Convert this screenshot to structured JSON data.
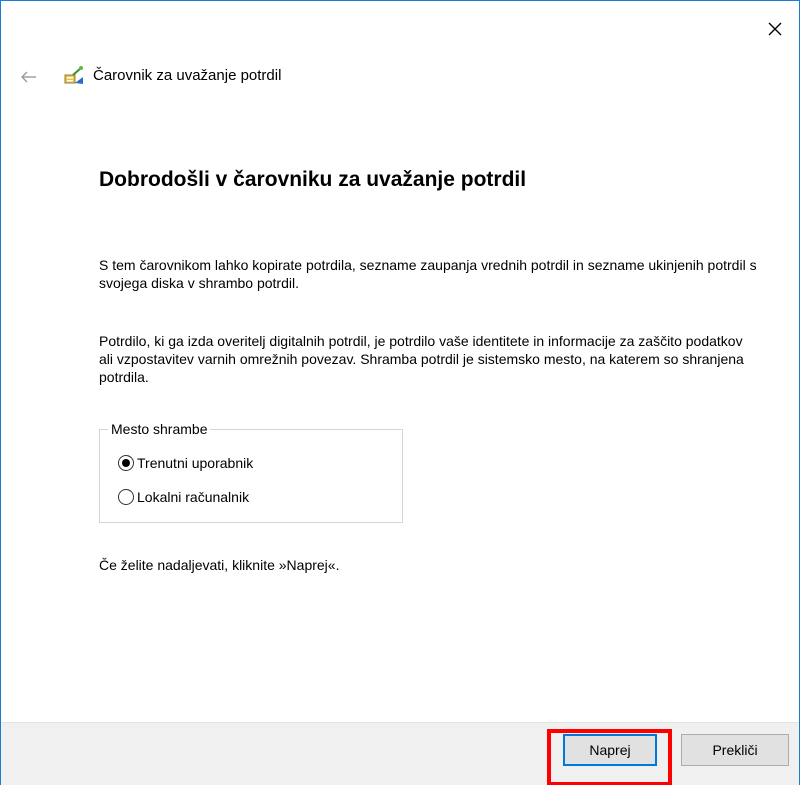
{
  "window": {
    "title": "Čarovnik za uvažanje potrdil"
  },
  "icons": {
    "close": "close-icon",
    "back": "back-arrow-icon",
    "wizard": "certificate-wizard-icon"
  },
  "content": {
    "heading": "Dobrodošli v čarovniku za uvažanje potrdil",
    "paragraph1": "S tem čarovnikom lahko kopirate potrdila, sezname zaupanja vrednih potrdil in sezname ukinjenih potrdil s svojega diska v shrambo potrdil.",
    "paragraph2": "Potrdilo, ki ga izda overitelj digitalnih potrdil, je potrdilo vaše identitete in informacije za zaščito podatkov ali vzpostavitev varnih omrežnih povezav. Shramba potrdil je sistemsko mesto, na katerem so shranjena potrdila.",
    "store_location": {
      "legend": "Mesto shrambe",
      "options": [
        {
          "label": "Trenutni uporabnik",
          "checked": true
        },
        {
          "label": "Lokalni računalnik",
          "checked": false
        }
      ]
    },
    "continue_text": "Če želite nadaljevati, kliknite »Naprej«."
  },
  "footer": {
    "next_label": "Naprej",
    "cancel_label": "Prekliči"
  },
  "colors": {
    "accent": "#0078d7",
    "highlight": "#ff0000",
    "footer_bg": "#f0f0f0"
  }
}
